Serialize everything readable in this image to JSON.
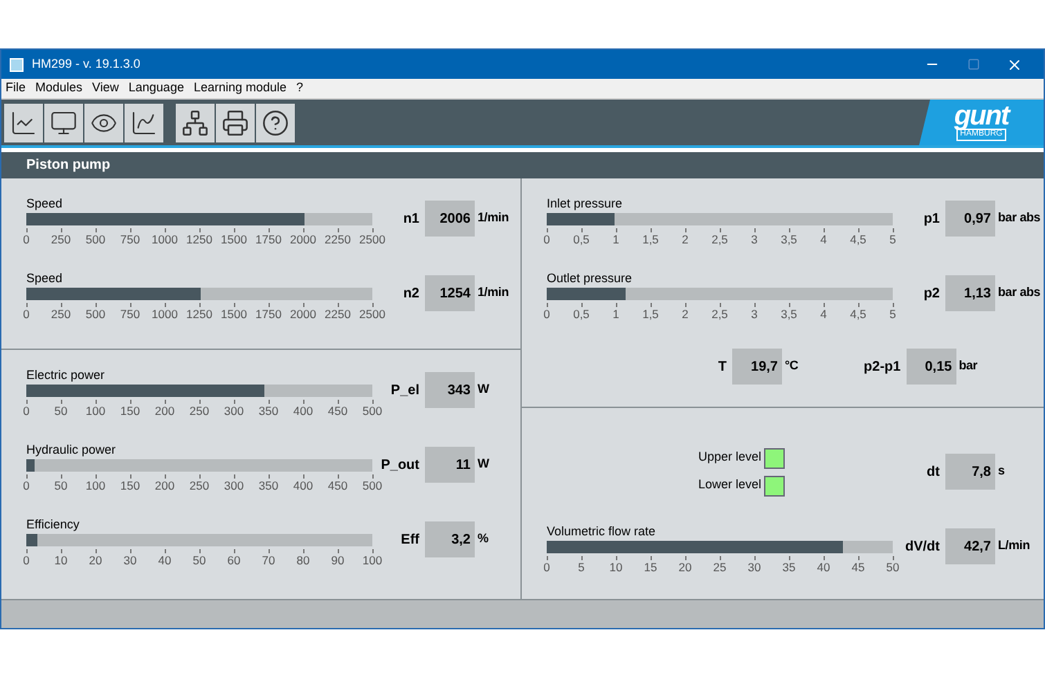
{
  "window": {
    "title": "HM299 - v. 19.1.3.0"
  },
  "menu": [
    "File",
    "Modules",
    "View",
    "Language",
    "Learning module",
    "?"
  ],
  "logo": {
    "name": "gunt",
    "subtitle": "HAMBURG"
  },
  "section": {
    "title": "Piston pump"
  },
  "left_top": [
    {
      "label": "Speed",
      "symbol": "n1",
      "value": "2006",
      "unit": "1/min",
      "level": 0.802,
      "ticks": [
        "0",
        "250",
        "500",
        "750",
        "1000",
        "1250",
        "1500",
        "1750",
        "2000",
        "2250",
        "2500"
      ]
    },
    {
      "label": "Speed",
      "symbol": "n2",
      "value": "1254",
      "unit": "1/min",
      "level": 0.502,
      "ticks": [
        "0",
        "250",
        "500",
        "750",
        "1000",
        "1250",
        "1500",
        "1750",
        "2000",
        "2250",
        "2500"
      ]
    }
  ],
  "left_bottom": [
    {
      "label": "Electric power",
      "symbol": "P_el",
      "value": "343",
      "unit": "W",
      "level": 0.686,
      "ticks": [
        "0",
        "50",
        "100",
        "150",
        "200",
        "250",
        "300",
        "350",
        "400",
        "450",
        "500"
      ]
    },
    {
      "label": "Hydraulic power",
      "symbol": "P_out",
      "value": "11",
      "unit": "W",
      "level": 0.022,
      "ticks": [
        "0",
        "50",
        "100",
        "150",
        "200",
        "250",
        "300",
        "350",
        "400",
        "450",
        "500"
      ]
    },
    {
      "label": "Efficiency",
      "symbol": "Eff",
      "value": "3,2",
      "unit": "%",
      "level": 0.032,
      "ticks": [
        "0",
        "10",
        "20",
        "30",
        "40",
        "50",
        "60",
        "70",
        "80",
        "90",
        "100"
      ]
    }
  ],
  "right_top": [
    {
      "label": "Inlet pressure",
      "symbol": "p1",
      "value": "0,97",
      "unit": "bar abs",
      "level": 0.194,
      "ticks": [
        "0",
        "0,5",
        "1",
        "1,5",
        "2",
        "2,5",
        "3",
        "3,5",
        "4",
        "4,5",
        "5"
      ]
    },
    {
      "label": "Outlet pressure",
      "symbol": "p2",
      "value": "1,13",
      "unit": "bar abs",
      "level": 0.226,
      "ticks": [
        "0",
        "0,5",
        "1",
        "1,5",
        "2",
        "2,5",
        "3",
        "3,5",
        "4",
        "4,5",
        "5"
      ]
    }
  ],
  "temperature": {
    "symbol": "T",
    "value": "19,7",
    "unit": "°C"
  },
  "pressure_difference": {
    "symbol": "p2-p1",
    "value": "0,15",
    "unit": "bar"
  },
  "levels": [
    {
      "label": "Upper level",
      "on": true
    },
    {
      "label": "Lower level",
      "on": true
    }
  ],
  "time": {
    "symbol": "dt",
    "value": "7,8",
    "unit": "s"
  },
  "flow": {
    "label": "Volumetric flow rate",
    "symbol": "dV/dt",
    "value": "42,7",
    "unit": "L/min",
    "level": 0.854,
    "ticks": [
      "0",
      "5",
      "10",
      "15",
      "20",
      "25",
      "30",
      "35",
      "40",
      "45",
      "50"
    ]
  }
}
